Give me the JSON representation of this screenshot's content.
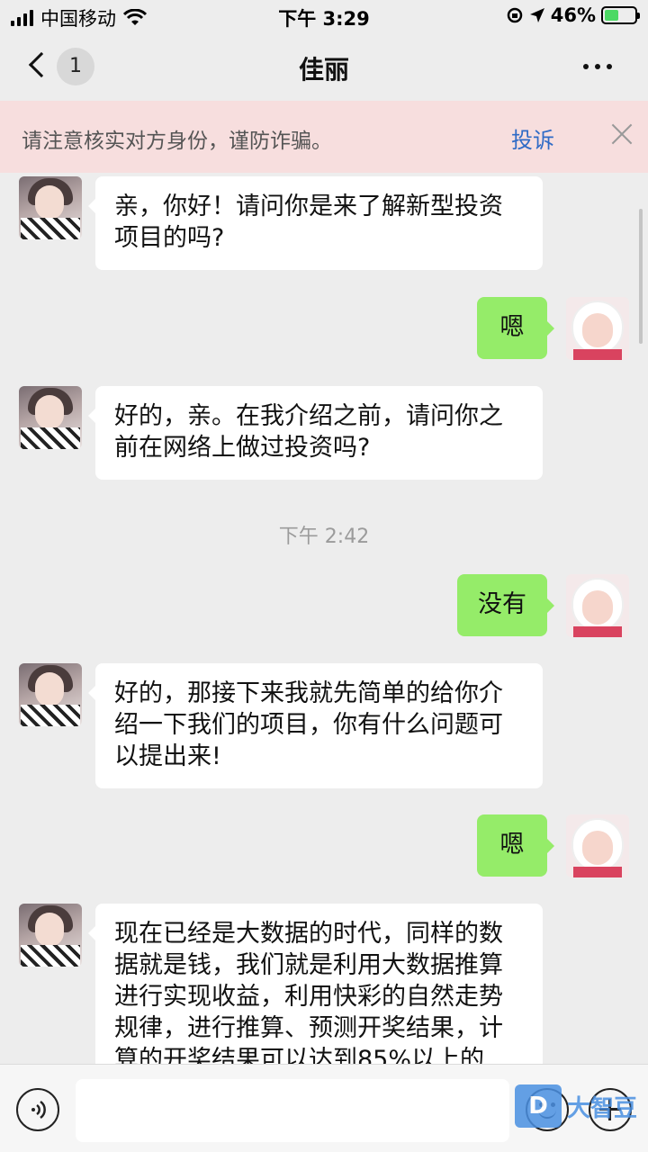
{
  "status_bar": {
    "carrier": "中国移动",
    "time": "下午 3:29",
    "battery_percent": "46%",
    "battery_level": 0.46
  },
  "nav": {
    "unread_count": "1",
    "title": "佳丽"
  },
  "warning": {
    "text": "请注意核实对方身份，谨防诈骗。",
    "complain_label": "投诉"
  },
  "messages": [
    {
      "from": "other",
      "text": "亲，你好！请问你是来了解新型投资\n项目的吗?"
    },
    {
      "from": "me",
      "text": "嗯"
    },
    {
      "from": "other",
      "text": "好的，亲。在我介绍之前，请问你之\n前在网络上做过投资吗?"
    },
    {
      "from": "me",
      "text": "没有"
    },
    {
      "from": "other",
      "text": "好的，那接下来我就先简单的给你介\n绍一下我们的项目，你有什么问题可\n以提出来!"
    },
    {
      "from": "me",
      "text": "嗯"
    },
    {
      "from": "other",
      "text": "现在已经是大数据的时代，同样的数\n据就是钱，我们就是利用大数据推算\n进行实现收益，利用快彩的自然走势\n规律，进行推算、预测开奖结果，计\n算的开奖结果可以达到85%以上的"
    }
  ],
  "timestamp": "下午 2:42",
  "watermark": {
    "logo": "D",
    "text": "大智豆"
  },
  "icons": {
    "back": "chevron-left-icon",
    "more": "more-dots-icon",
    "close": "close-icon",
    "voice": "voice-icon",
    "emoji": "emoji-icon",
    "plus": "plus-icon"
  },
  "colors": {
    "bubble_out": "#95ec69",
    "bubble_in": "#ffffff",
    "banner": "#f7dede",
    "link": "#2f6bc6"
  }
}
